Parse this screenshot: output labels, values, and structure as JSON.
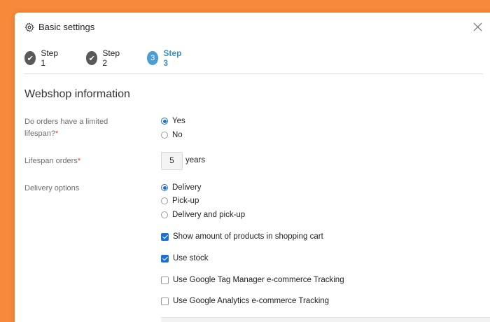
{
  "modal": {
    "title": "Basic settings",
    "icon": "gear-icon",
    "close_icon": "close-icon"
  },
  "steps": [
    {
      "label": "Step 1",
      "state": "done",
      "marker": "✔"
    },
    {
      "label": "Step 2",
      "state": "done",
      "marker": "✔"
    },
    {
      "label": "Step 3",
      "state": "active",
      "marker": "3"
    }
  ],
  "section": {
    "title": "Webshop information"
  },
  "fields": {
    "lifespan_limited": {
      "label": "Do orders have a limited lifespan?",
      "required_mark": "*",
      "options": [
        {
          "label": "Yes",
          "checked": true
        },
        {
          "label": "No",
          "checked": false
        }
      ]
    },
    "lifespan_orders": {
      "label": "Lifespan orders",
      "required_mark": "*",
      "value": "5",
      "unit": "years"
    },
    "delivery_options": {
      "label": "Delivery options",
      "options": [
        {
          "label": "Delivery",
          "checked": true
        },
        {
          "label": "Pick-up",
          "checked": false
        },
        {
          "label": "Delivery and pick-up",
          "checked": false
        }
      ]
    },
    "checkboxes": [
      {
        "label": "Show amount of products in shopping cart",
        "checked": true
      },
      {
        "label": "Use stock",
        "checked": true
      },
      {
        "label": "Use Google Tag Manager e-commerce Tracking",
        "checked": false
      },
      {
        "label": "Use Google Analytics e-commerce Tracking",
        "checked": false
      }
    ]
  },
  "colors": {
    "background": "#f6893a",
    "accent": "#4a9ed3",
    "step_done": "#595959",
    "control_checked": "#1b6fd8",
    "required": "#e23a3a"
  }
}
